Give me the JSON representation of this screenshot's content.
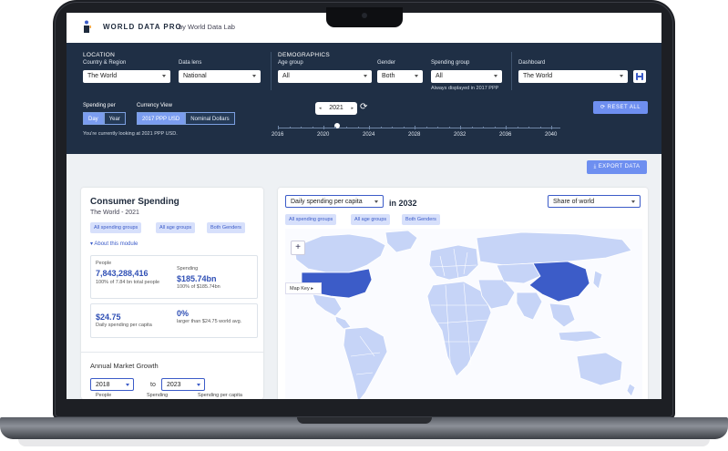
{
  "app": {
    "brand": "WORLD DATA PRO",
    "brand_sub": "by World Data Lab"
  },
  "filters": {
    "location": {
      "section_label": "LOCATION",
      "country_label": "Country & Region",
      "country_value": "The World",
      "lens_label": "Data lens",
      "lens_value": "National"
    },
    "demographics": {
      "section_label": "DEMOGRAPHICS",
      "age_label": "Age group",
      "age_value": "All",
      "gender_label": "Gender",
      "gender_value": "Both",
      "spending_label": "Spending group",
      "spending_value": "All",
      "spending_note": "Always displayed in 2017 PPP"
    },
    "dashboard": {
      "label": "Dashboard",
      "value": "The World"
    },
    "spending_per": {
      "label": "Spending per",
      "options": [
        "Day",
        "Year"
      ],
      "selected": "Day"
    },
    "currency": {
      "label": "Currency View",
      "options": [
        "2017 PPP USD",
        "Nominal Dollars"
      ],
      "selected": "2017 PPP USD"
    },
    "currency_note": "You're currently looking at 2021 PPP USD.",
    "year": {
      "value": "2021",
      "ticks": [
        "2016",
        "2020",
        "2024",
        "2028",
        "2032",
        "2036",
        "2040"
      ]
    },
    "reset_label": "RESET ALL"
  },
  "export_label": "EXPORT DATA",
  "consumer": {
    "title": "Consumer Spending",
    "subtitle": "The World - 2021",
    "chips": [
      "All spending groups",
      "All age groups",
      "Both Genders"
    ],
    "about": "About this module",
    "people_label": "People",
    "people_value": "7,843,288,416",
    "people_note": "100% of 7.84 bn total people",
    "spending_label": "Spending",
    "spending_value": "$185.74bn",
    "spending_note": "100% of $185.74bn",
    "per_capita_value": "$24.75",
    "per_capita_note": "Daily spending per capita",
    "pct_value": "0%",
    "pct_note": "larger than $24.75 world avg.",
    "growth_title": "Annual Market Growth",
    "from_year": "2018",
    "to_label": "to",
    "to_year": "2023",
    "table_headers": [
      "People",
      "Spending",
      "Spending per capita"
    ]
  },
  "map": {
    "metric_value": "Daily spending per capita",
    "in_year": "in 2032",
    "view_value": "Share of world",
    "chips": [
      "All spending groups",
      "All age groups",
      "Both Genders"
    ],
    "zoom_in": "+",
    "map_key": "Map Key",
    "colors": {
      "light": "#c6d4f7",
      "dark": "#3c5cc8",
      "border": "#ffffff"
    }
  }
}
